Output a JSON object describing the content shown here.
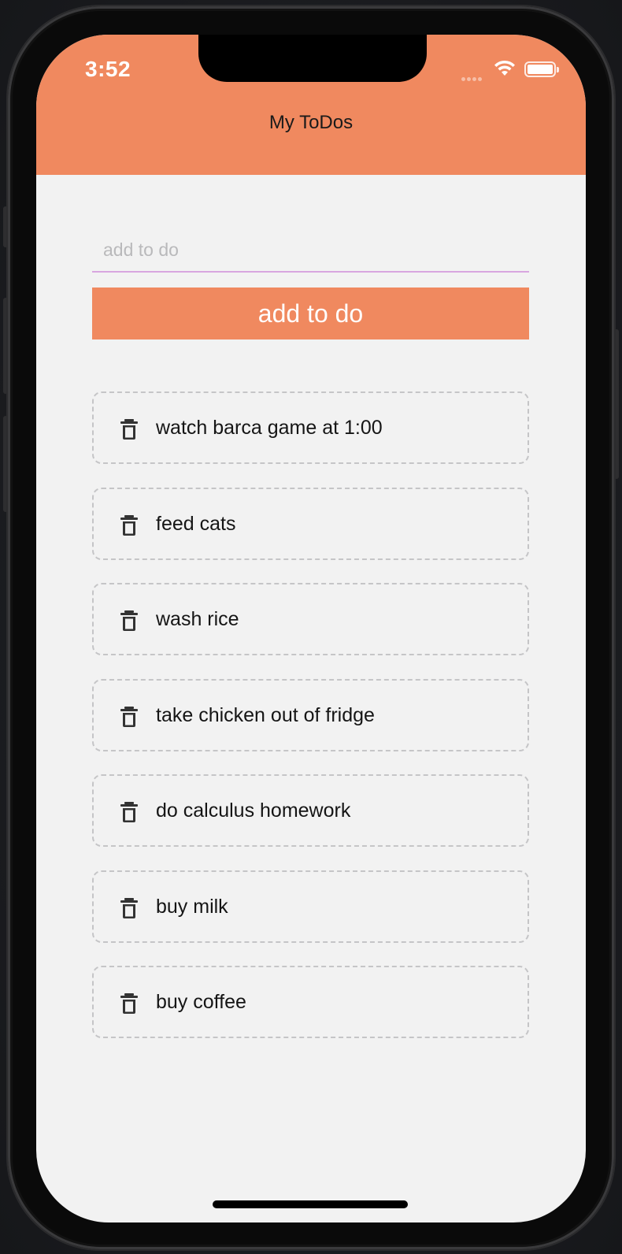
{
  "status_bar": {
    "time": "3:52"
  },
  "header": {
    "title": "My ToDos"
  },
  "form": {
    "input_value": "",
    "input_placeholder": "add to do",
    "add_button_label": "add to do"
  },
  "todos": [
    {
      "label": "watch barca game at 1:00"
    },
    {
      "label": "feed cats"
    },
    {
      "label": "wash rice"
    },
    {
      "label": "take chicken out of fridge"
    },
    {
      "label": "do calculus homework"
    },
    {
      "label": "buy milk"
    },
    {
      "label": "buy coffee"
    }
  ],
  "icons": {
    "delete": "trash-icon",
    "wifi": "wifi-icon",
    "battery": "battery-icon",
    "signal": "signal-icon"
  },
  "colors": {
    "accent": "#f0895f",
    "background": "#f2f2f2",
    "input_underline": "#d8a6e0",
    "item_border": "#c5c5c7"
  }
}
